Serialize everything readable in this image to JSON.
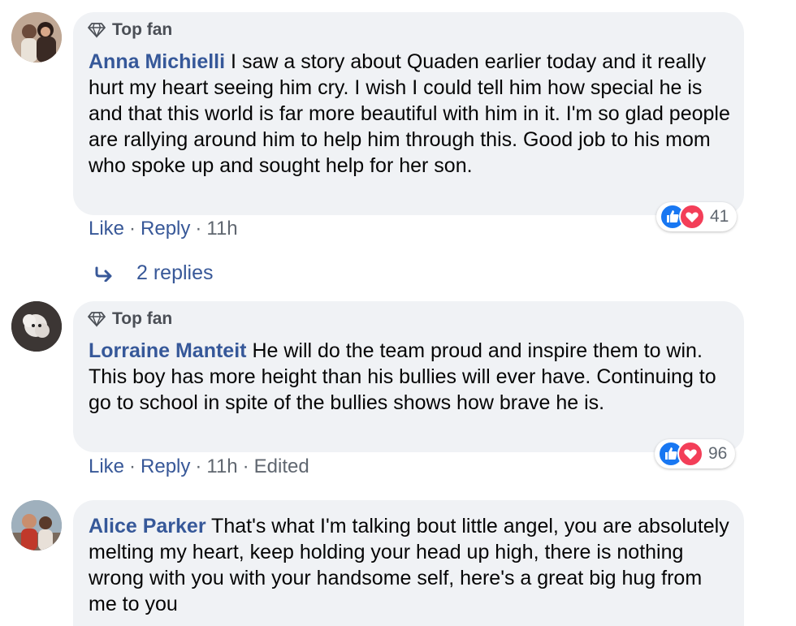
{
  "comments": [
    {
      "badge": "Top fan",
      "author": "Anna Michielli",
      "text": "I saw a story about Quaden earlier today and it really hurt my heart seeing him cry. I wish I could tell him how special he is and that this world is far more beautiful with him in it. I'm so glad people are rallying around him to help him through this. Good job to his mom who spoke up and sought help for her son.",
      "like": "Like",
      "reply": "Reply",
      "time": "11h",
      "reaction_count": "41"
    },
    {
      "badge": "Top fan",
      "author": "Lorraine Manteit",
      "text": "He will do the team proud and inspire them to win. This boy has more height than his bullies will ever have. Continuing to go to school in spite of the bullies shows how brave he is.",
      "like": "Like",
      "reply": "Reply",
      "time": "11h",
      "edited": "Edited",
      "reaction_count": "96"
    },
    {
      "author": "Alice Parker",
      "text": "That's what I'm talking bout little angel, you are absolutely melting my heart, keep holding your head up high, there is nothing wrong with you with your handsome self, here's a great big hug from me to you"
    }
  ],
  "replies_link": "2 replies",
  "colors": {
    "link": "#385898",
    "author": "#365899",
    "bubble": "#f0f2f5",
    "like": "#1877f2",
    "love": "#f33e58"
  }
}
